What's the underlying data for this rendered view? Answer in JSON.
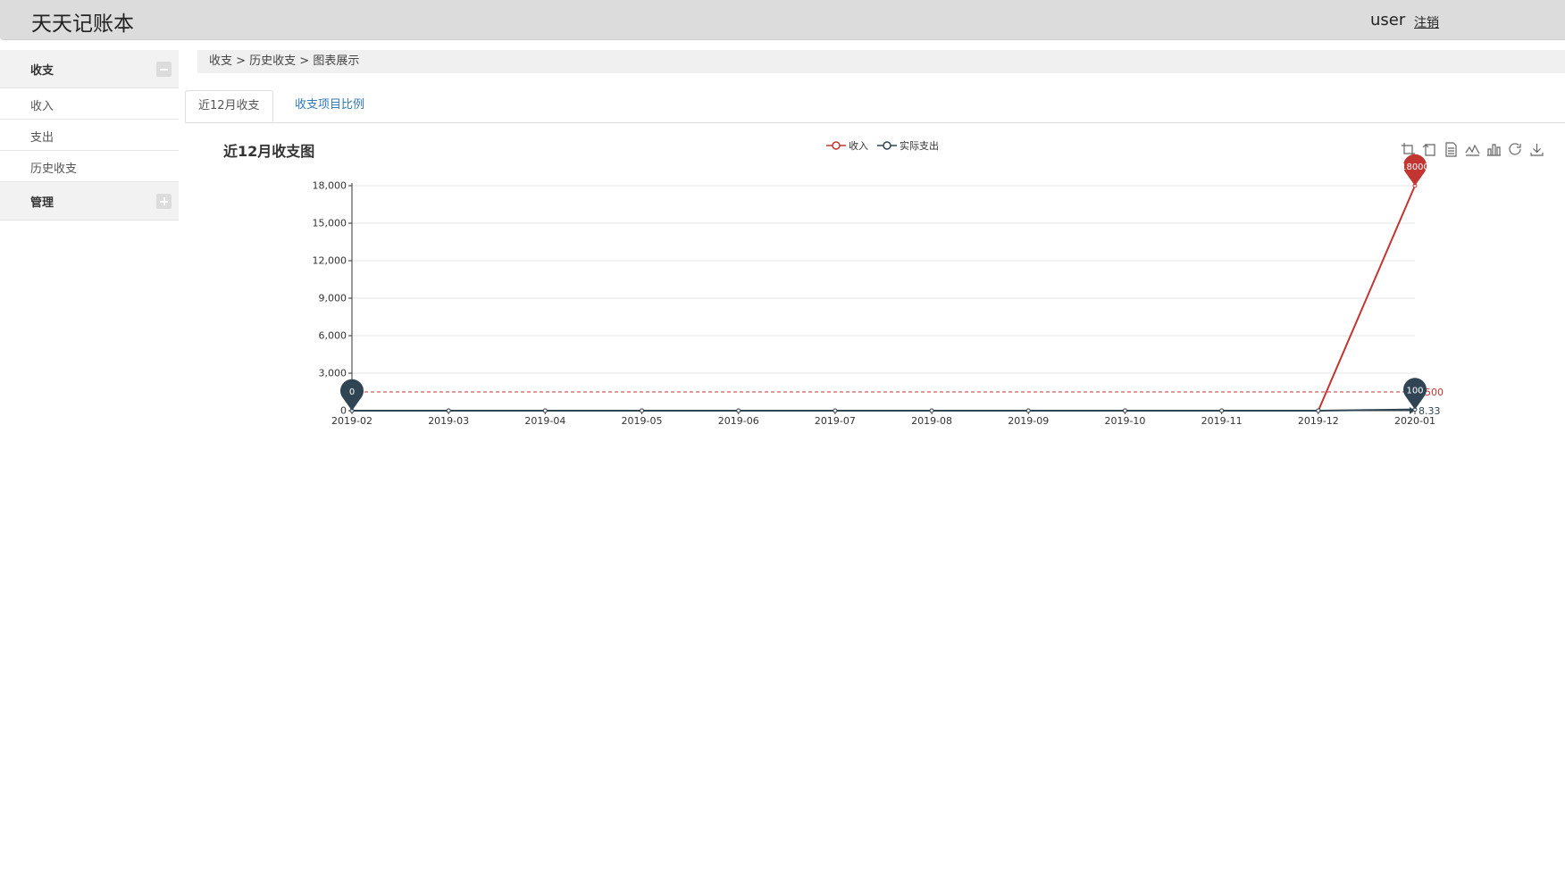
{
  "header": {
    "app_title": "天天记账本",
    "user_name": "user",
    "logout_label": "注销"
  },
  "sidebar": {
    "groups": [
      {
        "label": "收支",
        "expanded": true,
        "items": [
          "收入",
          "支出",
          "历史收支"
        ]
      },
      {
        "label": "管理",
        "expanded": false,
        "items": []
      }
    ]
  },
  "breadcrumb": "收支 > 历史收支 > 图表展示",
  "tabs": [
    {
      "label": "近12月收支",
      "active": true
    },
    {
      "label": "收支项目比例",
      "active": false
    }
  ],
  "chart_data": {
    "type": "line",
    "title": "近12月收支图",
    "categories": [
      "2019-02",
      "2019-03",
      "2019-04",
      "2019-05",
      "2019-06",
      "2019-07",
      "2019-08",
      "2019-09",
      "2019-10",
      "2019-11",
      "2019-12",
      "2020-01"
    ],
    "ylim": [
      0,
      18000
    ],
    "yticks": [
      0,
      3000,
      6000,
      9000,
      12000,
      15000,
      18000
    ],
    "ytick_labels": [
      "0",
      "3,000",
      "6,000",
      "9,000",
      "12,000",
      "15,000",
      "18,000"
    ],
    "grid": true,
    "legend_position": "top-center",
    "series": [
      {
        "name": "收入",
        "color": "#c23531",
        "values": [
          0,
          0,
          0,
          0,
          0,
          0,
          0,
          0,
          0,
          0,
          0,
          18000
        ],
        "max_marker": {
          "label": "18000",
          "index": 11,
          "value": 18000
        },
        "average_line": {
          "value": 1500,
          "label": "1500"
        }
      },
      {
        "name": "实际支出",
        "color": "#2f4554",
        "values": [
          0,
          0,
          0,
          0,
          0,
          0,
          0,
          0,
          0,
          0,
          0,
          100
        ],
        "min_marker": {
          "label": "0",
          "index": 0,
          "value": 0
        },
        "max_marker": {
          "label": "100",
          "index": 11,
          "value": 100
        },
        "average_line": {
          "value": 8.33,
          "label": "8.33"
        }
      }
    ]
  },
  "toolbox_icons": [
    "zoom-icon",
    "zoom-reset-icon",
    "data-view-icon",
    "line-chart-icon",
    "bar-chart-icon",
    "restore-icon",
    "save-image-icon"
  ]
}
